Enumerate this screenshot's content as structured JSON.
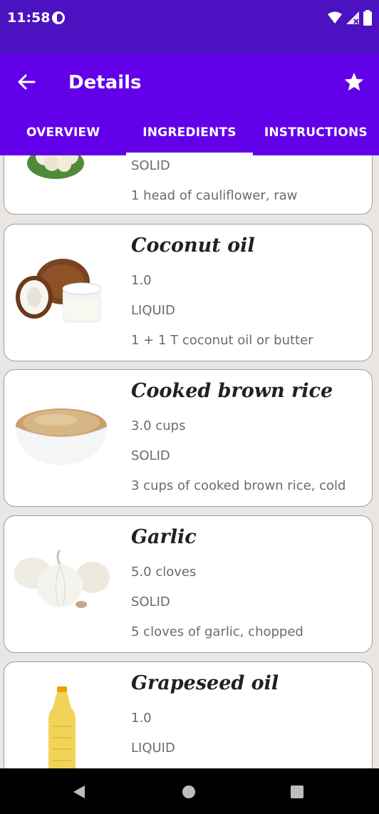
{
  "status_bar": {
    "time": "11:58"
  },
  "app_bar": {
    "title": "Details"
  },
  "tabs": [
    {
      "label": "OVERVIEW"
    },
    {
      "label": "INGREDIENTS"
    },
    {
      "label": "INSTRUCTIONS"
    }
  ],
  "ingredients": [
    {
      "name": "",
      "amount": "",
      "type": "SOLID",
      "description": "1 head of cauliflower, raw"
    },
    {
      "name": "Coconut oil",
      "amount": "1.0",
      "type": "LIQUID",
      "description": "1 + 1 T coconut oil or butter"
    },
    {
      "name": "Cooked brown rice",
      "amount": "3.0  cups",
      "type": "SOLID",
      "description": "3 cups of cooked brown rice, cold"
    },
    {
      "name": "Garlic",
      "amount": "5.0  cloves",
      "type": "SOLID",
      "description": "5 cloves of garlic, chopped"
    },
    {
      "name": "Grapeseed oil",
      "amount": "1.0",
      "type": "LIQUID",
      "description": ""
    }
  ],
  "colors": {
    "status_bar": "#4c11c0",
    "app_bar": "#6200ea",
    "background": "#e9e6e4"
  }
}
